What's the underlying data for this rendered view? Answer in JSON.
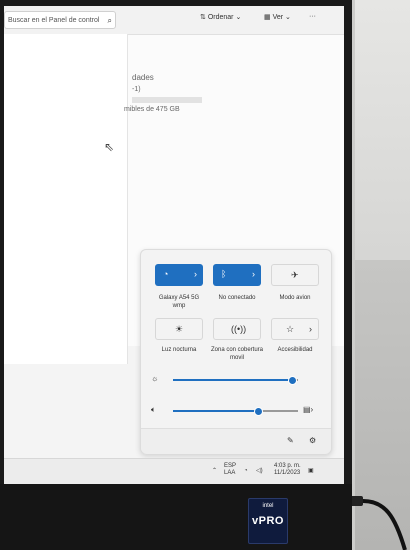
{
  "explorer": {
    "search_placeholder": "Buscar en el Panel de control",
    "toolbar": {
      "sort": "Ordenar",
      "view": "Ver"
    },
    "properties": {
      "title": "dades",
      "line2": "-1)",
      "free_space": "mibles de 475 GB"
    }
  },
  "quick_settings": {
    "tiles": [
      {
        "label": "Galaxy A54 5G\nwmp",
        "icon": "wifi-icon",
        "active": true
      },
      {
        "label": "No conectado",
        "icon": "bluetooth-icon",
        "active": true
      },
      {
        "label": "Modo avion",
        "icon": "airplane-icon",
        "active": false
      },
      {
        "label": "Luz nocturna",
        "icon": "night-light-icon",
        "active": false
      },
      {
        "label": "Zona con cobertura\nmovil",
        "icon": "hotspot-icon",
        "active": false
      },
      {
        "label": "Accesibilidad",
        "icon": "accessibility-icon",
        "active": false
      }
    ],
    "brightness": 0.95,
    "volume": 0.68
  },
  "taskbar": {
    "lang_top": "ESP",
    "lang_bottom": "LAA",
    "time": "4:03 p. m.",
    "date": "11/1/2023"
  },
  "hardware": {
    "sticker_top": "intel",
    "sticker_main": "vPRO"
  },
  "colors": {
    "accent": "#1f6fc0",
    "bezel": "#151515"
  }
}
